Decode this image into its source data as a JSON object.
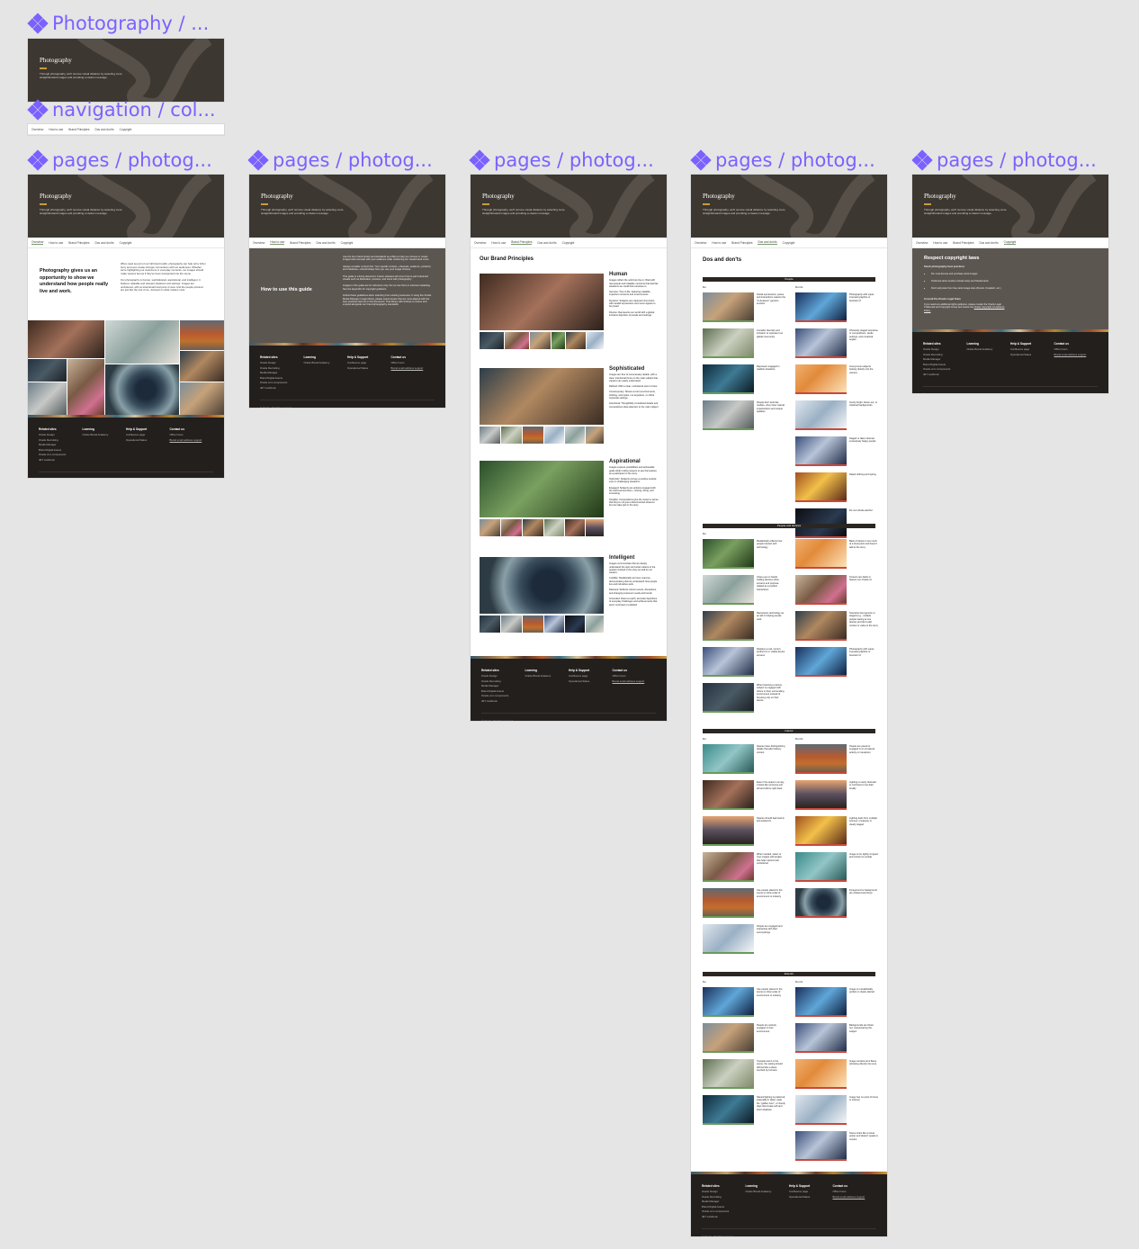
{
  "canvas": {
    "frame_labels": [
      "Photography / ...",
      "navigation / col...",
      "pages / photog...",
      "pages / photog...",
      "pages / photog...",
      "pages / photog...",
      "pages / photog..."
    ]
  },
  "hero": {
    "title": "Photography",
    "description": "Through photography, we'll remove visual distance by selecting more straightforward images and providing a clearer message."
  },
  "nav": {
    "items": [
      "Overview",
      "How to use",
      "Brand Principles",
      "Dos and don'ts",
      "Copyright"
    ]
  },
  "overview": {
    "headline": "Photography gives us an opportunity to show we understand how people really live and work.",
    "para1": "When used as part of our full brand toolkit, photography can help tell a richer story and even create stronger connections with our audiences. Whether we're highlighting our customers or everyday moments, our images should make viewers feel as if they've been transported into the scene.",
    "para2": "Our photography is human, sophisticated, aspirational, and intelligent. It features relatable and relevant situations and settings. Images are uncluttered, with an intentional focal point of view. And the people pictured are just like the rest of us—focused on what matters most."
  },
  "how_to_use": {
    "title": "How to use this guide",
    "bullets": [
      "Use the four brand tenets and standards as a filter to help you choose or create images that resonate with your audience while reinforcing our visual brand voice.",
      "Always consider context first. Your specific context—channels, audience, products, and industries—should shape how you use your image choices.",
      "This guide is a living document. Future releases will cover how to pair brand-led visuals such as illustration, textures, and icons with photography.",
      "Images in this guide are for reference only. Do not use them in external marketing. See the Appendix for copyright guidance.",
      "Follow these guidelines when selecting from existing resources. If using the Oracle Media Manager Image library, please select assets that are most aligned with the best practices laid out in this document. That library will continue to evolve and expand alongside our brand photography standards."
    ]
  },
  "principles": {
    "title": "Our Brand Principles",
    "items": [
      {
        "name": "Human",
        "intro": "Images reflect the world we live in, filled with real people and relatable moments that feel like situations we could find ourselves in.",
        "bullets": [
          "Genuine: True to life, featuring relatable, imperfect moments and environments",
          "Dynamic: Subjects are captured mid-motion with candid expressions and never appear to be posed",
          "Diverse: Represents our world with a global, inclusive depiction of people and settings"
        ]
      },
      {
        "name": "Sophisticated",
        "intro": "Images are free of unnecessary details, with a clear, intentional focus on the main subject that viewers can easily understand.",
        "bullets": [
          "Refined: With a clear, uncluttered point of view",
          "Contemporary: Shows current environments, clothing, and styles, not anywhere, or cliché corporate settings",
          "Intentional: Thoughtfully considered details and compositions draw attention to the main subject"
        ]
      },
      {
        "name": "Aspirational",
        "intro": "Images express possibilities and achievable goals while inviting viewers to see themselves as a participant in the story.",
        "bullets": [
          "Optimistic: Subjects convey a positive outlook even in challenging situations",
          "Engaged: Subjects are actively engaged with the world around them—driving, doing, and innovating",
          "Tangible: Compositions give the viewer a sense that they're not just a disconnected observer but can take part in the story"
        ]
      },
      {
        "name": "Intelligent",
        "intro": "Images communicate that we deeply understand the topic and what matters to the people involved in the story as well as our viewers.",
        "bullets": [
          "Credible: Realistically we have nuances, demonstrating that we understand how people live and industries work",
          "Relevant: Reflects current events, disruptions, and changing customer needs and trends",
          "Grounded: Down-to-earth, accurate depictions of everyday challenges and achievements that aren't contrived or polished"
        ]
      }
    ]
  },
  "dos_donts": {
    "title": "Dos and don'ts",
    "do_label": "Do",
    "dont_label": "Don'ts",
    "sections": [
      {
        "name": "People",
        "dos": [
          "Social expressions, poses, and interactions capture the \"in-between\" genuine emotion",
          "Consider diversity and inclusion to represent our global community",
          "Represent engaged in realistic situations",
          "People don't look like models—they have natural imperfections and unique qualities"
        ],
        "donts": [
          "Photography with super-imposed graphics or futuristic UI",
          "Obviously staged scenarios or compositions, studio settings, and unnatural angles",
          "Anonymous subjects looking directly into the camera",
          "Overly bright, blown-out, or cluttered backgrounds",
          "Staged or taken dramas: excessively happy people",
          "Dated clothing and styling",
          "Do not include alcohol"
        ]
      },
      {
        "name": "People and devices",
        "dos": [
          "Realistically reflects how people interact with technology",
          "Close-ups on hands holding devices show screens and purpose-related as a product interactions",
          "Represents technology as an aid in helping people work",
          "Displays a real, current product UI or visible device screens",
          "When featuring a device, subject is engaged with others or their surrounding environment instead of focusing only on their device"
        ],
        "donts": [
          "Back of device is too much of a focal point and doesn't add to the story",
          "Screens are blank or feature non-Oracle UI",
          "Scenarios feel generic or staged (e.g., multiple people staring at one device) and don't add context or value to the story",
          "Photography with super-imposed graphics or futuristic UI"
        ]
      },
      {
        "name": "Interior",
        "dos": [
          "Spaces have distinguishing details that add industry context",
          "Even if the space is empty, it looks like someone just left and will be right back",
          "Spaces should feel lived-in and worked in",
          "When needed, select or crop images with angles that help interiors feel uncluttered",
          "Use people placed in the scene to show scale of environment or industry",
          "People are engaged and interacting with their surroundings"
        ],
        "donts": [
          "People are posed or engaged in an unnatural activity or interaction",
          "Lighting is overly dramatic or contrived or too dark tonally",
          "Lighting feels from multiple sources, unnatural, or clearly staged",
          "Image is too tightly cropped and context is unclear",
          "Foreground or background are cluttered and busy"
        ]
      },
      {
        "name": "Exterior",
        "dos": [
          "Use people placed in the scene to show scale of environment or industry",
          "People are actively engaged in their environment",
          "If people aren't in the scene, the setting should still feel like a place touched by humans",
          "Natural lighting is preferred, especially in dawn, dusk, the \"golden hour\", or cloudy days that create soft and short shadows"
        ],
        "donts": [
          "Image is unrealistically perfect or clearly altered",
          "Backgrounds are blown out, overpowering the subject",
          "Image contains lens flares (shooting directly into sun)",
          "Image has no point of focus or interest",
          "Scene looks like a travel poster and doesn't speak to context"
        ]
      }
    ]
  },
  "copyright": {
    "title": "Respect copyright laws",
    "subhead": "Stock photography best practices",
    "bullets": [
      "Do: must license and purchase stock images",
      "Preferred stock vendors include Getty and Shutterstock",
      "Don't pull posts from free stock image sites (Pexels, Unsplash, etc.)"
    ],
    "consult_head": "Consult the Oracle Legal Team",
    "consult_text": "If you need any additional rights guidance, please contact the Oracle Legal Trademark and Copyright Group and review the",
    "consult_link": "Oracle Copyright Compliance Policy."
  },
  "footer": {
    "columns": [
      {
        "heading": "Related sites",
        "links": [
          "Oracle Design",
          "Oracle Recruiting",
          "Media Manager",
          "Brand Digital Assets",
          "Oracle.com components",
          "JET cookbook"
        ]
      },
      {
        "heading": "Learning",
        "links": [
          "Oracle Brand Academy"
        ]
      },
      {
        "heading": "Help & Support",
        "links": [
          "Confluence page",
          "Operational Status"
        ]
      },
      {
        "heading": "Contact us",
        "links": [
          "Office hours",
          "Brand email address support"
        ]
      }
    ],
    "copyright": "© Oracle. All rights reserved."
  }
}
